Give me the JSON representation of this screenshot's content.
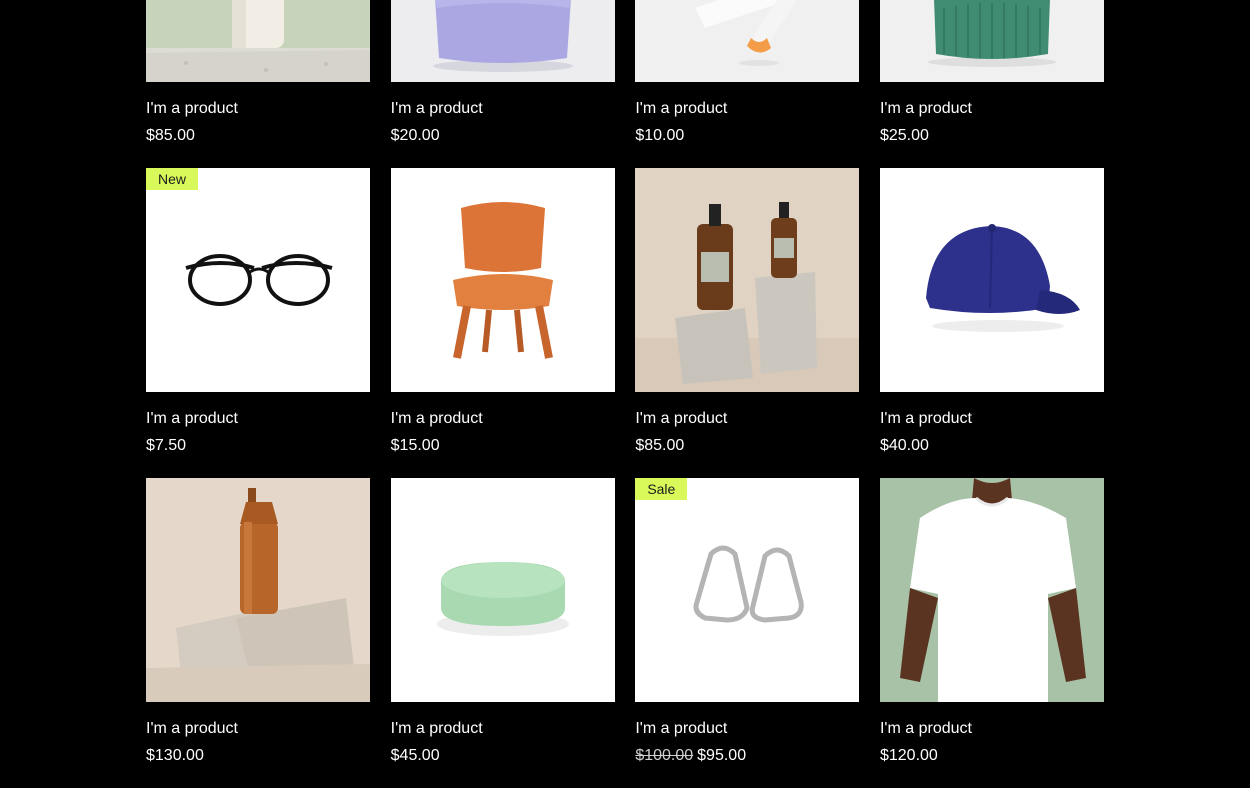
{
  "colors": {
    "background": "#000000",
    "ribbon": "#d9f95b",
    "text": "#ffffff"
  },
  "products": [
    {
      "name": "I'm a product",
      "price": "$85.00",
      "image": "bottle-on-stone-image",
      "bg": "#c9d6bd"
    },
    {
      "name": "I'm a product",
      "price": "$20.00",
      "image": "lavender-pillow-image",
      "bg": "#e8e8ec"
    },
    {
      "name": "I'm a product",
      "price": "$10.00",
      "image": "orange-tube-image",
      "bg": "#f1f1f1"
    },
    {
      "name": "I'm a product",
      "price": "$25.00",
      "image": "green-beanie-image",
      "bg": "#efefef"
    },
    {
      "name": "I'm a product",
      "price": "$7.50",
      "image": "eyeglasses-image",
      "bg": "#ffffff",
      "ribbon": "New"
    },
    {
      "name": "I'm a product",
      "price": "$15.00",
      "image": "wooden-chair-image",
      "bg": "#ffffff"
    },
    {
      "name": "I'm a product",
      "price": "$85.00",
      "image": "amber-bottles-image",
      "bg": "#e2d5c6"
    },
    {
      "name": "I'm a product",
      "price": "$40.00",
      "image": "blue-cap-image",
      "bg": "#ffffff"
    },
    {
      "name": "I'm a product",
      "price": "$130.00",
      "image": "copper-water-bottle-image",
      "bg": "#e3d6c8"
    },
    {
      "name": "I'm a product",
      "price": "$45.00",
      "image": "mint-soap-image",
      "bg": "#ffffff"
    },
    {
      "name": "I'm a product",
      "old_price": "$100.00",
      "price": "$95.00",
      "image": "silver-earrings-image",
      "bg": "#ffffff",
      "ribbon": "Sale"
    },
    {
      "name": "I'm a product",
      "price": "$120.00",
      "image": "white-tshirt-image",
      "bg": "#a9c3a8"
    }
  ]
}
